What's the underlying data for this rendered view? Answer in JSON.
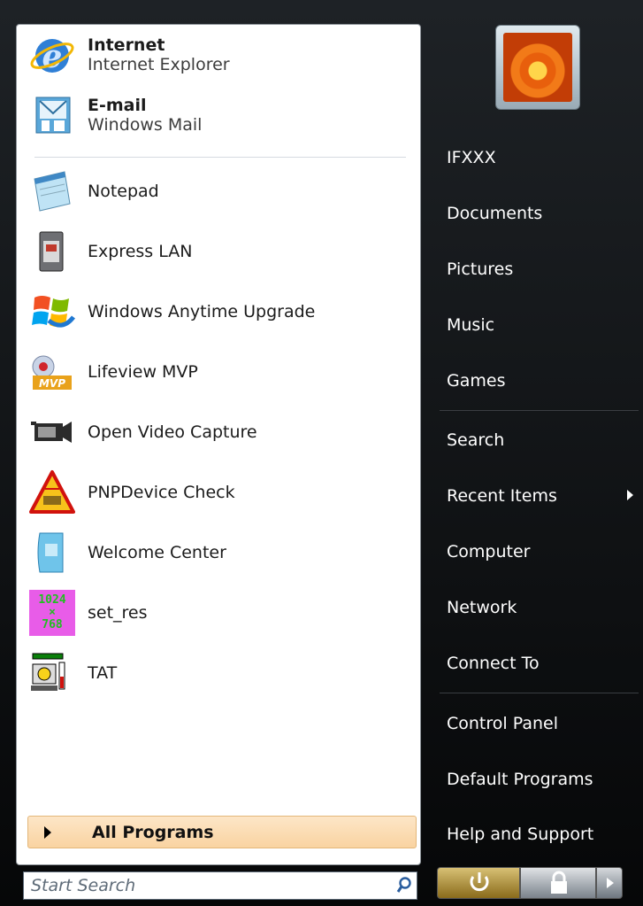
{
  "left_pane": {
    "pinned": [
      {
        "title": "Internet",
        "subtitle": "Internet Explorer",
        "icon": "internet-explorer-icon"
      },
      {
        "title": "E-mail",
        "subtitle": "Windows Mail",
        "icon": "windows-mail-icon"
      }
    ],
    "recent": [
      {
        "label": "Notepad",
        "icon": "notepad-icon"
      },
      {
        "label": "Express LAN",
        "icon": "express-lan-icon"
      },
      {
        "label": "Windows Anytime Upgrade",
        "icon": "windows-logo-icon"
      },
      {
        "label": "Lifeview MVP",
        "icon": "lifeview-mvp-icon"
      },
      {
        "label": "Open Video Capture",
        "icon": "video-camera-icon"
      },
      {
        "label": "PNPDevice Check",
        "icon": "warning-triangle-icon"
      },
      {
        "label": "Welcome Center",
        "icon": "welcome-center-icon"
      },
      {
        "label": "set_res",
        "icon": "set-res-icon"
      },
      {
        "label": "TAT",
        "icon": "tat-icon"
      }
    ],
    "all_programs_label": "All Programs"
  },
  "search": {
    "placeholder": "Start Search"
  },
  "right_pane": {
    "user_name": "IFXXX",
    "items": [
      "Documents",
      "Pictures",
      "Music",
      "Games",
      "Search",
      "Recent Items",
      "Computer",
      "Network",
      "Connect To",
      "Control Panel",
      "Default Programs",
      "Help and Support"
    ]
  },
  "set_res_icon_text": {
    "line1": "1024",
    "line2": "×",
    "line3": "768"
  },
  "colors": {
    "menu_bg": "#0d0f11",
    "all_programs_bg": "#fbdcb2",
    "text_right": "#ffffff"
  }
}
